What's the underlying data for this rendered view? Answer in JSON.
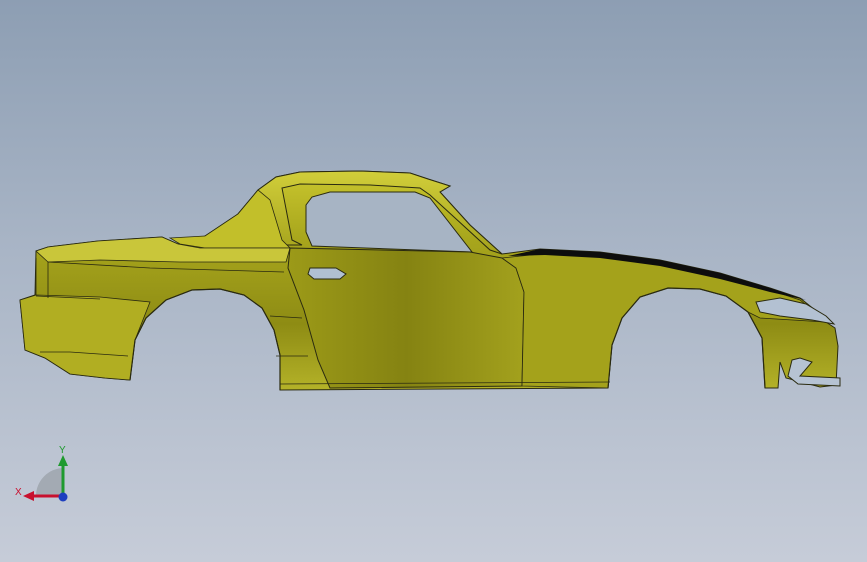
{
  "viewport": {
    "background_top": "#8d9eb3",
    "background_bottom": "#c6ccd8"
  },
  "model": {
    "body_color": "#a7a51d",
    "body_shadow_color": "#7f7d12",
    "edge_color": "#2a2a10",
    "hood_stripe_color": "#0d0d0d"
  },
  "triad": {
    "x_label": "X",
    "y_label": "Y",
    "x_color": "#c8102e",
    "y_color": "#1f9a2f",
    "z_color": "#1e3fbf"
  }
}
